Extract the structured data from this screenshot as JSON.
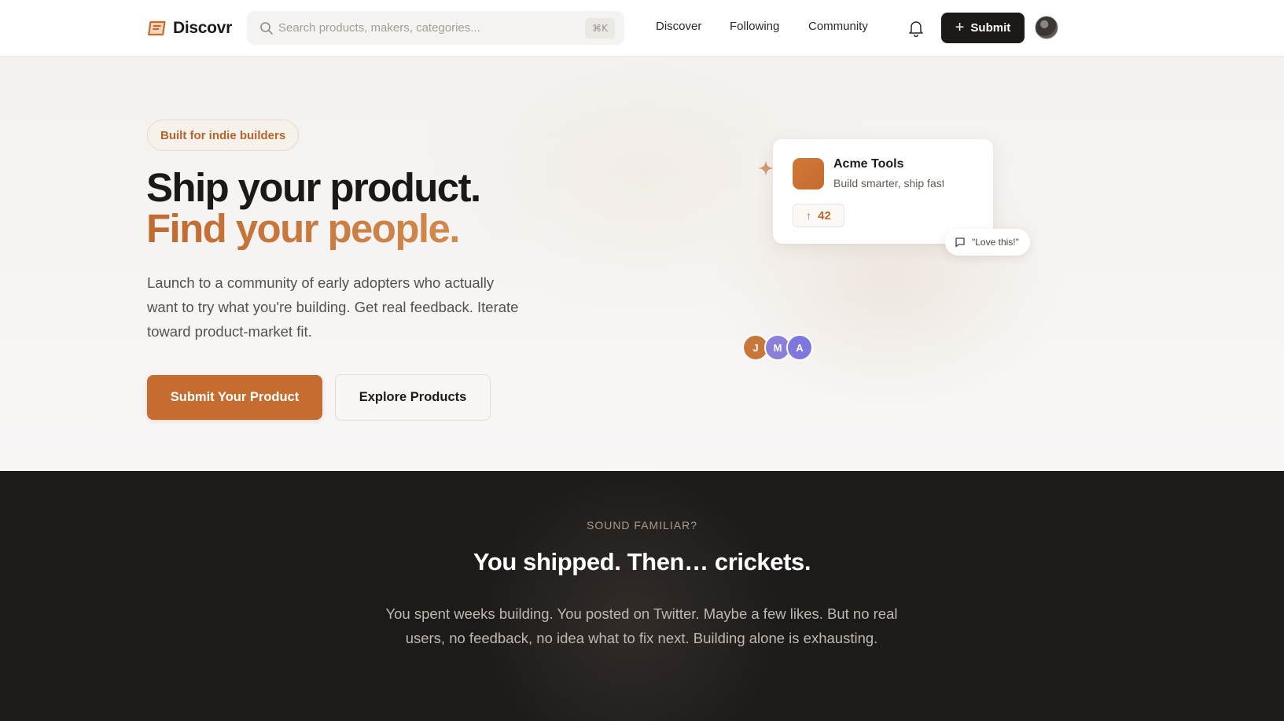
{
  "brand": {
    "name": "Discovr",
    "accent": "#c56d30"
  },
  "search": {
    "placeholder": "Search products, makers, categories...",
    "shortcut": "⌘K",
    "icon": "search-icon"
  },
  "nav": {
    "items": [
      "Discover",
      "Following",
      "Community"
    ],
    "bell_icon": "bell-icon"
  },
  "header_submit": {
    "label": "Submit",
    "icon": "plus-icon"
  },
  "hero": {
    "pill": "Built for indie builders",
    "title_line1": "Ship your product.",
    "title_line2": "Find your people.",
    "lead": "Launch to a community of early adopters who actually want to try what you're building. Get real feedback. Iterate toward product-market fit.",
    "primary_cta": "Submit Your Product",
    "secondary_cta": "Explore Products"
  },
  "product_card": {
    "name": "Acme Tools",
    "tagline": "Build smarter, ship faster",
    "upvotes": "42",
    "comment": "\"Love this!\""
  },
  "avatars": [
    {
      "initial": "J",
      "color": "#c8773a"
    },
    {
      "initial": "M",
      "color": "#8b7fd9"
    },
    {
      "initial": "A",
      "color": "#7d78df"
    }
  ],
  "problem": {
    "eyebrow": "SOUND FAMILIAR?",
    "title": "You shipped. Then… crickets.",
    "body": "You spent weeks building. You posted on Twitter. Maybe a few likes. But no real users, no feedback, no idea what to fix next. Building alone is exhausting."
  }
}
